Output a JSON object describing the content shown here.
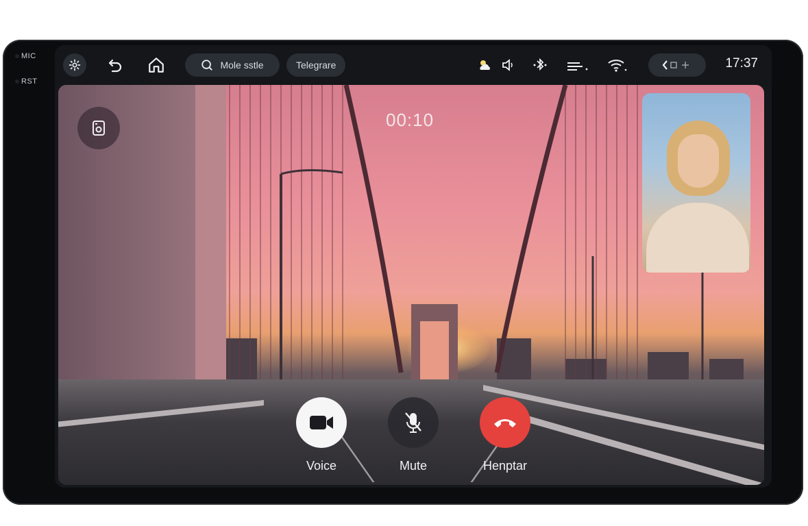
{
  "hardware": {
    "mic_label": "MIC",
    "rst_label": "RST"
  },
  "statusbar": {
    "settings_icon": "gear-icon",
    "back_icon": "back-arrow-icon",
    "home_icon": "home-icon",
    "pill1_label": "Mole sstle",
    "pill2_label": "Telegrare",
    "clock": "17:37"
  },
  "call": {
    "timer": "00:10",
    "controls": [
      {
        "label": "Voice"
      },
      {
        "label": "Mute"
      },
      {
        "label": "Henptar"
      }
    ]
  },
  "colors": {
    "end_call": "#e5423d",
    "video_btn": "#f5f5f5",
    "mute_btn": "#2b2c31"
  }
}
